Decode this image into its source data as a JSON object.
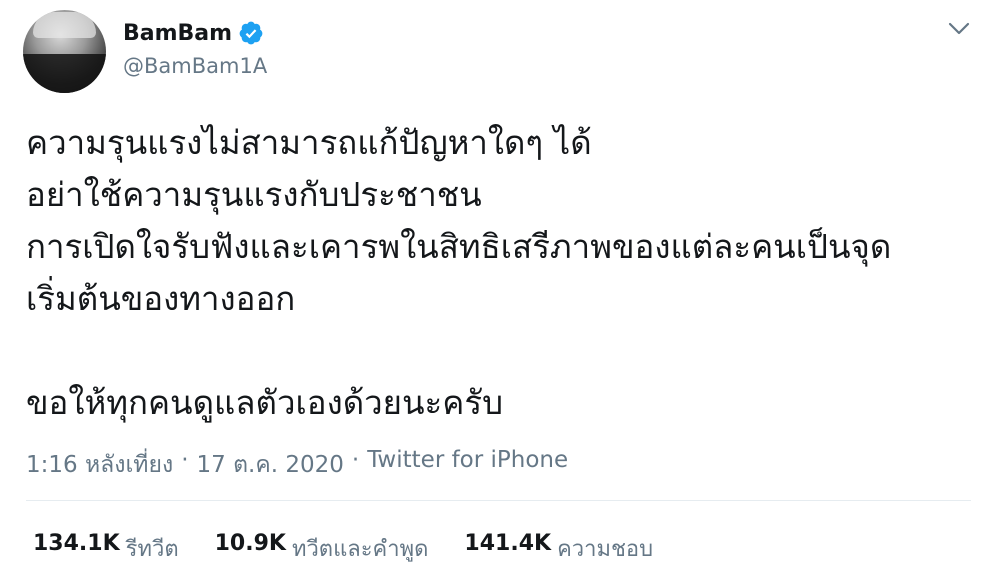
{
  "user": {
    "display_name": "BamBam",
    "handle": "@BamBam1A",
    "verified": true,
    "verified_color": "#1da1f2"
  },
  "tweet": {
    "lines": [
      "ความรุนแรงไม่สามารถแก้ปัญหาใดๆ ได้",
      "อย่าใช้ความรุนแรงกับประชาชน",
      "การเปิดใจรับฟังและเคารพในสิทธิเสรีภาพของแต่ละคนเป็นจุด",
      "เริ่มต้นของทางออก",
      "",
      "ขอให้ทุกคนดูแลตัวเองด้วยนะครับ"
    ]
  },
  "meta": {
    "time": "1:16 หลังเที่ยง",
    "separator": "·",
    "date": "17 ต.ค. 2020",
    "source": "Twitter for iPhone"
  },
  "stats": {
    "retweets_count": "134.1K",
    "retweets_label": "รีทวีต",
    "quotes_count": "10.9K",
    "quotes_label": "ทวีตและคำพูด",
    "likes_count": "141.4K",
    "likes_label": "ความชอบ"
  },
  "icons": {
    "verified": "verified-badge-icon",
    "caret": "chevron-down-icon"
  },
  "colors": {
    "text_primary": "#14171a",
    "text_secondary": "#657786",
    "divider": "#e6ecf0",
    "accent": "#1da1f2"
  }
}
